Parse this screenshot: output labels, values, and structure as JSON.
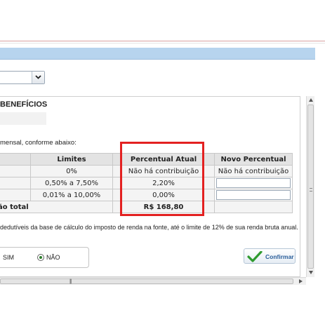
{
  "section": {
    "title": "BENEFÍCIOS",
    "intro": "mensal, conforme abaixo:"
  },
  "table": {
    "headers": [
      "",
      "Limites",
      "Percentual Atual",
      "Novo Percentual"
    ],
    "rows": [
      [
        "",
        "0%",
        "Não há contribuição",
        "Não há contribuição"
      ],
      [
        "",
        "0,50% a 7,50%",
        "2,20%",
        ""
      ],
      [
        "",
        "0,01% a 10,00%",
        "0,00%",
        ""
      ]
    ],
    "total_label": "ão total",
    "total_value": "R$ 168,80"
  },
  "note": "dedutíveis da base de cálculo do imposto de renda na fonte, até o limite de 12% de sua renda bruta anual.",
  "options": {
    "sim_label": "SIM",
    "nao_label": "NÃO",
    "selected": "NÃO"
  },
  "confirm_label": "Confirmar",
  "colors": {
    "highlight": "#e32121",
    "header_band": "#b7d4ee",
    "confirm_text": "#2b5f9a",
    "confirm_check": "#2f9b2f"
  },
  "icons": [
    "chevron-down-icon",
    "check-icon",
    "radio-icon",
    "scroll-arrow-icon",
    "scroll-grip-icon"
  ]
}
